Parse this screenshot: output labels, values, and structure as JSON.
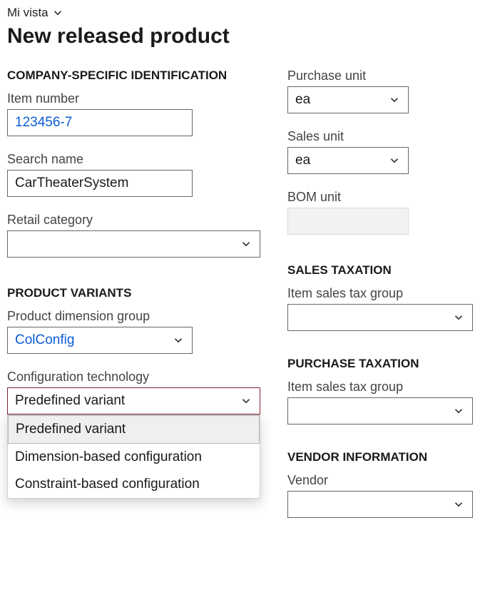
{
  "view_switch": "Mi vista",
  "page_title": "New released product",
  "left": {
    "section_company": "COMPANY-SPECIFIC IDENTIFICATION",
    "item_number_label": "Item number",
    "item_number_value": "123456-7",
    "search_name_label": "Search name",
    "search_name_value": "CarTheaterSystem",
    "retail_category_label": "Retail category",
    "retail_category_value": "",
    "section_variants": "PRODUCT VARIANTS",
    "dim_group_label": "Product dimension group",
    "dim_group_value": "ColConfig",
    "config_tech_label": "Configuration technology",
    "config_tech_value": "Predefined variant",
    "config_tech_options": {
      "o0": "Predefined variant",
      "o1": "Dimension-based configuration",
      "o2": "Constraint-based configuration"
    }
  },
  "right": {
    "purchase_unit_label": "Purchase unit",
    "purchase_unit_value": "ea",
    "sales_unit_label": "Sales unit",
    "sales_unit_value": "ea",
    "bom_unit_label": "BOM unit",
    "bom_unit_value": "",
    "section_sales_tax": "SALES TAXATION",
    "sales_tax_group_label": "Item sales tax group",
    "sales_tax_group_value": "",
    "section_purchase_tax": "PURCHASE TAXATION",
    "purchase_tax_group_label": "Item sales tax group",
    "purchase_tax_group_value": "",
    "section_vendor": "VENDOR INFORMATION",
    "vendor_label": "Vendor",
    "vendor_value": ""
  }
}
